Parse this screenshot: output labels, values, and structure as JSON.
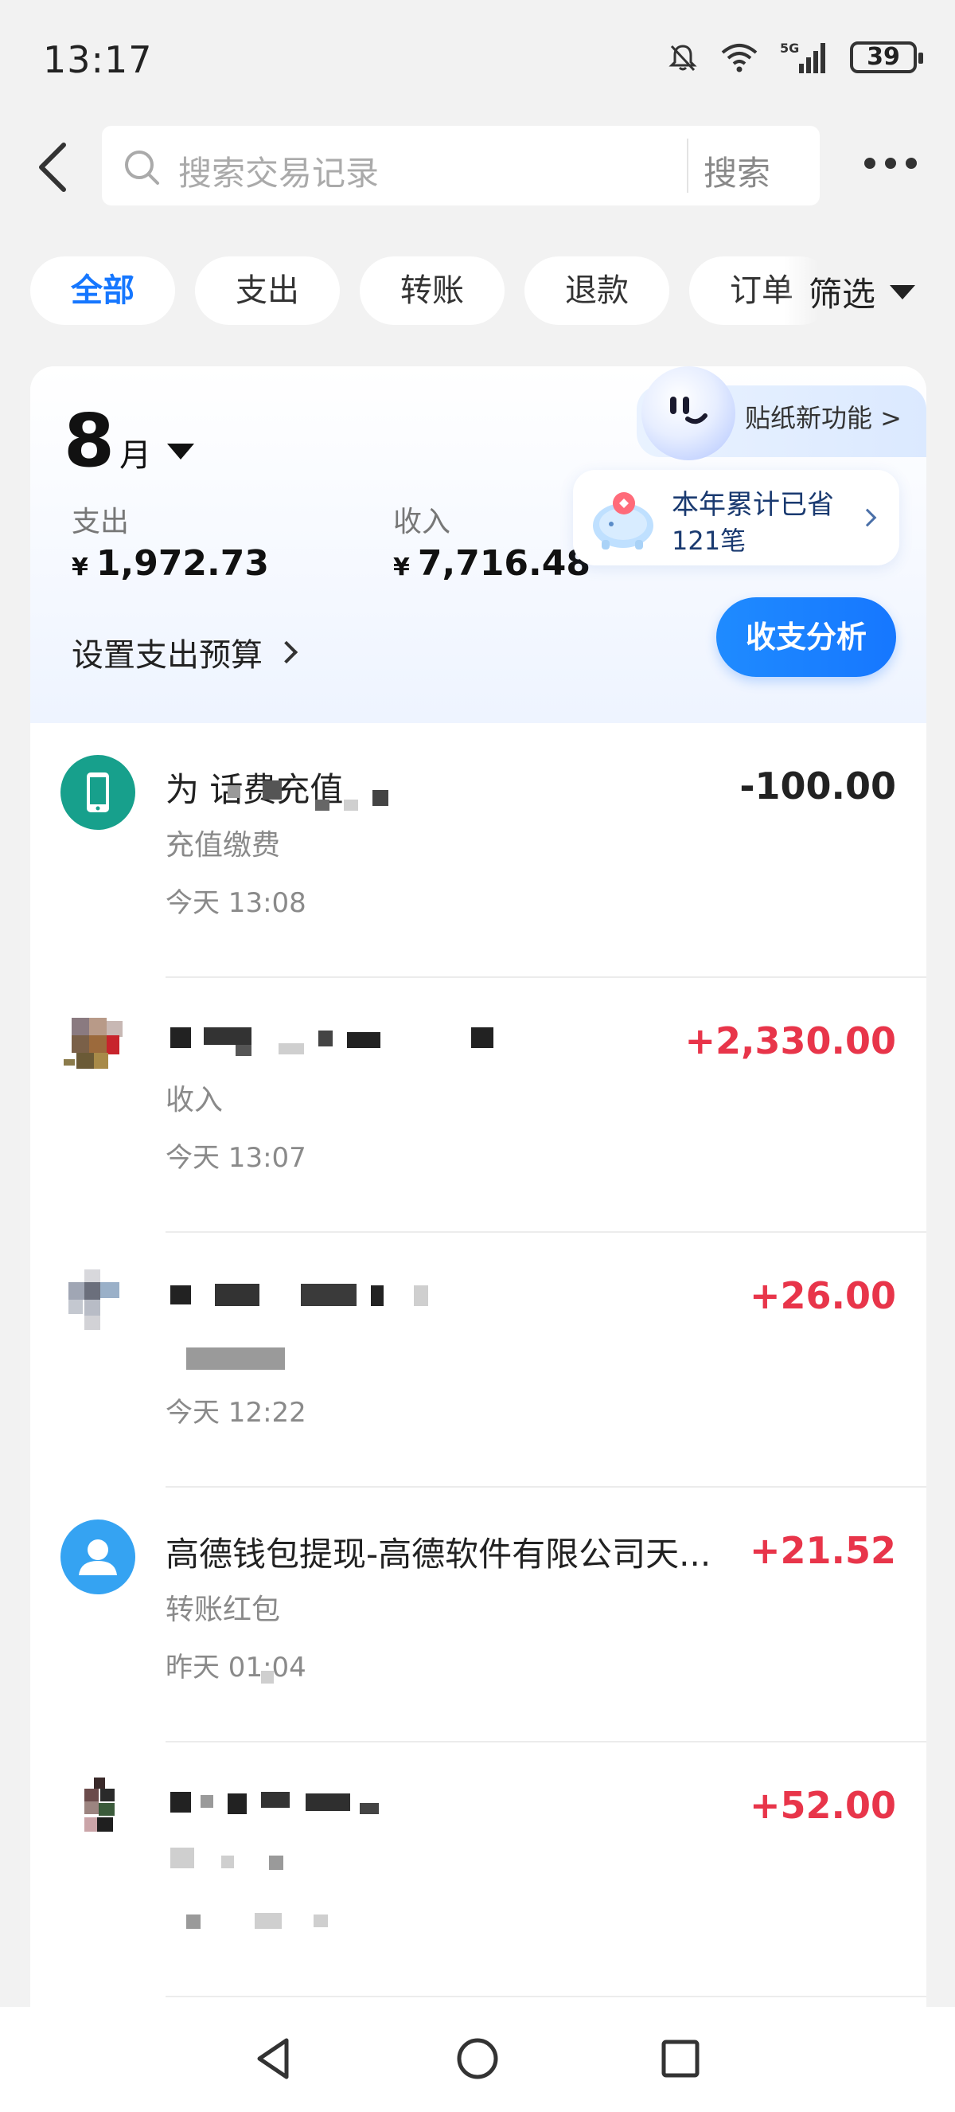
{
  "status_bar": {
    "time": "13:17",
    "battery": "39",
    "icons": [
      "bell-mute-icon",
      "wifi-icon",
      "5g-signal-icon",
      "battery-icon"
    ]
  },
  "header": {
    "search_placeholder": "搜索交易记录",
    "search_button": "搜索"
  },
  "filters": {
    "tabs": [
      "全部",
      "支出",
      "转账",
      "退款",
      "订单"
    ],
    "active": "全部",
    "filter_button": "筛选"
  },
  "summary": {
    "month_number": "8",
    "month_unit": "月",
    "expense_label": "支出",
    "expense_value": "1,972.73",
    "income_label": "收入",
    "income_value": "7,716.48",
    "currency": "¥",
    "budget_label": "设置支出预算",
    "sticker_label": "贴纸新功能 >",
    "saved_title": "本年累计已省",
    "saved_count": "121笔",
    "analysis_button": "收支分析"
  },
  "transactions": [
    {
      "title": "为          话费充值",
      "category": "充值缴费",
      "time": "今天 13:08",
      "amount": "-100.00",
      "sign": "neg"
    },
    {
      "title": "",
      "category": "收入",
      "time": "今天 13:07",
      "amount": "+2,330.00",
      "sign": "pos"
    },
    {
      "title": "",
      "category": "",
      "time": "今天 12:22",
      "amount": "+26.00",
      "sign": "pos"
    },
    {
      "title": "高德钱包提现-高德软件有限公司天...",
      "category": "转账红包",
      "time": "昨天 01:04",
      "amount": "+21.52",
      "sign": "pos"
    },
    {
      "title": "",
      "category": "",
      "time": "",
      "amount": "+52.00",
      "sign": "pos"
    }
  ],
  "colors": {
    "accent": "#1677ff",
    "positive_amount": "#e8354a",
    "negative_amount": "#222222",
    "phone_icon_bg": "#17a08c",
    "user_icon_bg": "#35a3f2"
  }
}
